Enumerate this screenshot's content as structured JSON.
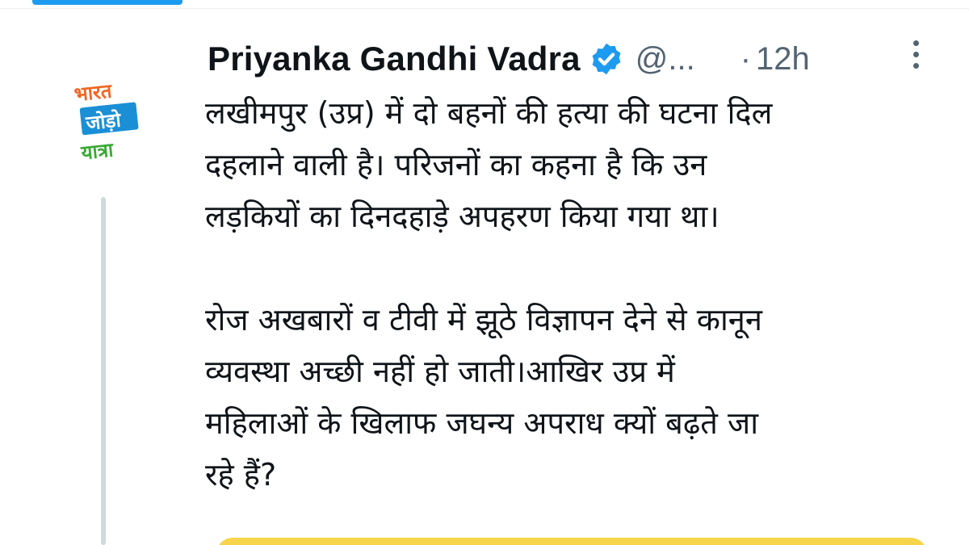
{
  "tweet": {
    "author": {
      "display_name": "Priyanka Gandhi Vadra",
      "handle": "@...",
      "verified": true,
      "avatar_logo_text": [
        "भारत",
        "जोड़ो",
        "यात्रा"
      ]
    },
    "separator": "·",
    "time": "12h",
    "paragraphs": [
      {
        "lines": [
          "लखीमपुर (उप्र) में दो बहनों की हत्या की घटना दिल",
          "दहलाने वाली है। परिजनों का कहना है कि उन",
          "लड़कियों का दिनदहाड़े अपहरण किया गया था।"
        ]
      },
      {
        "lines": [
          "रोज अखबारों व टीवी में झूठे विज्ञापन देने से कानून",
          "व्यवस्था अच्छी नहीं हो जाती।आखिर उप्र में",
          "महिलाओं के खिलाफ जघन्य अपराध क्यों बढ़ते जा",
          "रहे हैं?"
        ]
      }
    ]
  },
  "icons": {
    "verified": "verified-badge-icon",
    "more": "more-options-icon"
  },
  "colors": {
    "accent": "#1d9bf0",
    "text_primary": "#0f1419",
    "text_secondary": "#536471",
    "thread_line": "#cfd9de",
    "logo_orange": "#f26522",
    "logo_blue": "#1b8fd6",
    "logo_green": "#3aa935",
    "card_yellow": "#f7d54a"
  }
}
